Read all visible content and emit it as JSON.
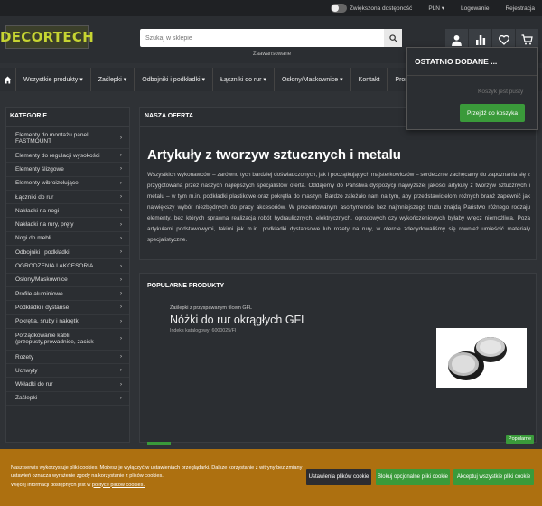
{
  "topbar": {
    "accessibility": "Zwiększona dostępność",
    "currency": "PLN ▾",
    "login": "Logowanie",
    "register": "Rejestracja"
  },
  "header": {
    "logo": "DECORTECH",
    "search_placeholder": "Szukaj w sklepie",
    "advanced": "Zaawansowane"
  },
  "nav": {
    "items": [
      "Wszystkie produkty ▾",
      "Zaślepki ▾",
      "Odbojniki i podkładki ▾",
      "Łączniki do rur ▾",
      "Osłony/Maskownice ▾",
      "Kontakt",
      "Promocja"
    ]
  },
  "recent": {
    "title": "OSTATNIO DODANE ...",
    "info": "Koszyk jest pusty",
    "button": "Przejdź do koszyka"
  },
  "sidebar": {
    "title": "KATEGORIE",
    "items": [
      "Elementy do montażu paneli FASTMOUNT",
      "Elementy do regulacji wysokości",
      "Elementy ślizgowe",
      "Elementy wibroizolujące",
      "Łączniki do rur",
      "Nakładki na nogi",
      "Nakładki na rury, pręty",
      "Nogi do mebli",
      "Odbojniki i podkładki",
      "OGRODZENIA I AKCESORIA",
      "Osłony/Maskownice",
      "Profile aluminiowe",
      "Podkładki i dystanse",
      "Pokrętła, śruby i nakrętki",
      "Porządkowanie kabli (przepusty,prowadnice, zacisk",
      "Rozety",
      "Uchwyty",
      "Wkładki do rur",
      "Zaślepki"
    ]
  },
  "offer": {
    "title": "NASZA OFERTA",
    "heading": "Artykuły z tworzyw sztucznych i metalu",
    "text": "Wszystkich wykonawców – zarówno tych bardziej doświadczonych, jak i początkujących majsterkowiczów – serdecznie zachęcamy do zapoznania się z przygotowaną przez naszych najlepszych specjalistów ofertą. Oddajemy do Państwa dyspozycji najwyższej jakości artykuły z tworzyw sztucznych i metalu – w tym m.in. podkładki plastikowe oraz pokrętła do maszyn. Bardzo zależało nam na tym, aby przedstawicielom różnych branż zapewnić jak największy wybór niezbędnych do pracy akcesoriów. W prezentowanym asortymencie bez najmniejszego trudu znajdą Państwo różnego rodzaju elementy, bez których sprawna realizacja robót hydraulicznych, elektrycznych, ogrodowych czy wykończeniowych byłaby wręcz niemożliwa. Poza artykułami podstawowymi, takimi jak m.in. podkładki dystansowe lub rozety na rury, w ofercie zdecydowaliśmy się również umieścić materiały specjalistyczne."
  },
  "popular": {
    "title": "POPULARNE PRODUKTY",
    "category": "Zaślepki z przyspawanym filcem GFL",
    "name": "Nóżki do rur okrągłych GFL",
    "index": "Indeks katalogowy: 6000025/FI",
    "badge": "Popularne"
  },
  "cookie": {
    "line1": "Nasz serwis wykorzystuje pliki cookies. Możesz je wyłączyć w ustawieniach przeglądarki. Dalsze korzystanie z witryny bez zmiany",
    "line2": "ustawień oznacza wyrażenie zgody na korzystanie z plików cookies.",
    "line3_pre": "Więcej informacji dostępnych jest w ",
    "line3_link": "polityce plików cookies.",
    "btn_settings": "Ustawienia plików cookie",
    "btn_block": "Blokuj opcjonalne pliki cookie",
    "btn_accept": "Akceptuj wszystkie pliki cookie"
  }
}
